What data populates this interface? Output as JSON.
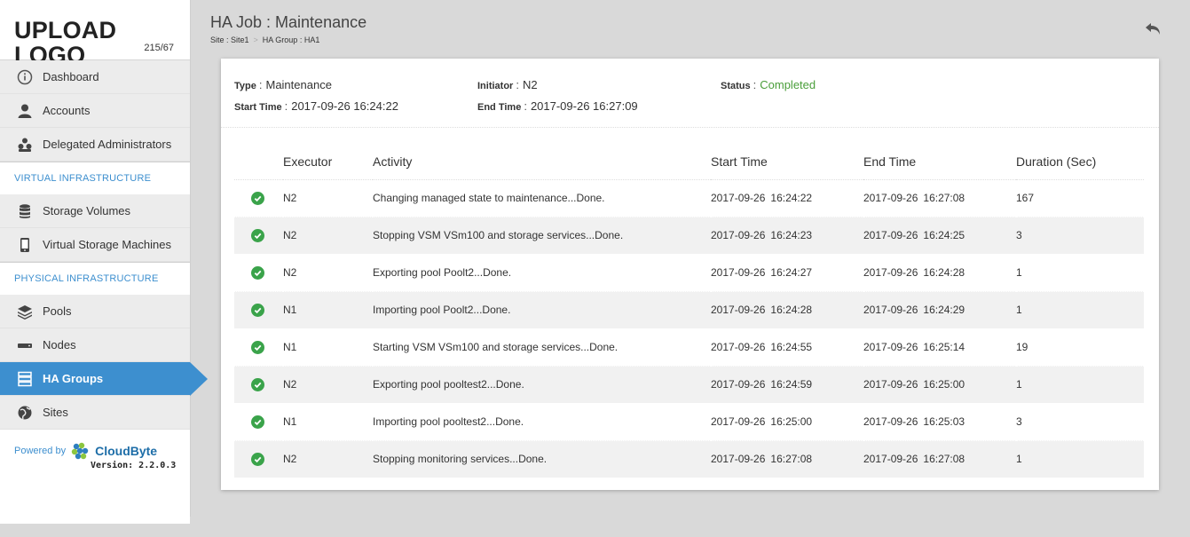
{
  "logo": {
    "text": "UPLOAD LOGO",
    "dim": "215/67"
  },
  "nav": {
    "items": [
      {
        "label": "Dashboard",
        "icon": "info-icon"
      },
      {
        "label": "Accounts",
        "icon": "user-icon"
      },
      {
        "label": "Delegated Administrators",
        "icon": "users-icon"
      }
    ],
    "sections": [
      {
        "title": "VIRTUAL INFRASTRUCTURE",
        "items": [
          {
            "label": "Storage Volumes",
            "icon": "database-icon"
          },
          {
            "label": "Virtual Storage Machines",
            "icon": "mobile-icon"
          }
        ]
      },
      {
        "title": "PHYSICAL INFRASTRUCTURE",
        "items": [
          {
            "label": "Pools",
            "icon": "layers-icon"
          },
          {
            "label": "Nodes",
            "icon": "nodes-icon"
          },
          {
            "label": "HA Groups",
            "icon": "server-icon",
            "active": true
          },
          {
            "label": "Sites",
            "icon": "globe-icon"
          }
        ]
      }
    ]
  },
  "footer": {
    "powered_by": "Powered by",
    "brand": "CloudByte",
    "version": "Version: 2.2.0.3"
  },
  "page": {
    "title": "HA Job : Maintenance",
    "breadcrumb": [
      "Site : Site1",
      "HA Group : HA1"
    ]
  },
  "summary": {
    "type_label": "Type",
    "type_value": "Maintenance",
    "initiator_label": "Initiator",
    "initiator_value": "N2",
    "status_label": "Status",
    "status_value": "Completed",
    "start_label": "Start Time",
    "start_value": "2017-09-26 16:24:22",
    "end_label": "End Time",
    "end_value": "2017-09-26 16:27:09"
  },
  "table": {
    "headers": [
      "Executor",
      "Activity",
      "Start Time",
      "End Time",
      "Duration (Sec)"
    ],
    "rows": [
      {
        "executor": "N2",
        "activity": "Changing managed state to maintenance...Done.",
        "start_date": "2017-09-26",
        "start_time": "16:24:22",
        "end_date": "2017-09-26",
        "end_time": "16:27:08",
        "duration": "167"
      },
      {
        "executor": "N2",
        "activity": "Stopping VSM VSm100 and storage services...Done.",
        "start_date": "2017-09-26",
        "start_time": "16:24:23",
        "end_date": "2017-09-26",
        "end_time": "16:24:25",
        "duration": "3"
      },
      {
        "executor": "N2",
        "activity": "Exporting pool Poolt2...Done.",
        "start_date": "2017-09-26",
        "start_time": "16:24:27",
        "end_date": "2017-09-26",
        "end_time": "16:24:28",
        "duration": "1"
      },
      {
        "executor": "N1",
        "activity": "Importing pool Poolt2...Done.",
        "start_date": "2017-09-26",
        "start_time": "16:24:28",
        "end_date": "2017-09-26",
        "end_time": "16:24:29",
        "duration": "1"
      },
      {
        "executor": "N1",
        "activity": "Starting VSM VSm100 and storage services...Done.",
        "start_date": "2017-09-26",
        "start_time": "16:24:55",
        "end_date": "2017-09-26",
        "end_time": "16:25:14",
        "duration": "19"
      },
      {
        "executor": "N2",
        "activity": "Exporting pool pooltest2...Done.",
        "start_date": "2017-09-26",
        "start_time": "16:24:59",
        "end_date": "2017-09-26",
        "end_time": "16:25:00",
        "duration": "1"
      },
      {
        "executor": "N1",
        "activity": "Importing pool pooltest2...Done.",
        "start_date": "2017-09-26",
        "start_time": "16:25:00",
        "end_date": "2017-09-26",
        "end_time": "16:25:03",
        "duration": "3"
      },
      {
        "executor": "N2",
        "activity": "Stopping monitoring services...Done.",
        "start_date": "2017-09-26",
        "start_time": "16:27:08",
        "end_date": "2017-09-26",
        "end_time": "16:27:08",
        "duration": "1"
      }
    ]
  },
  "colors": {
    "accent": "#3d8fcf",
    "success": "#3aa34a",
    "status_completed": "#4a9e3a"
  }
}
